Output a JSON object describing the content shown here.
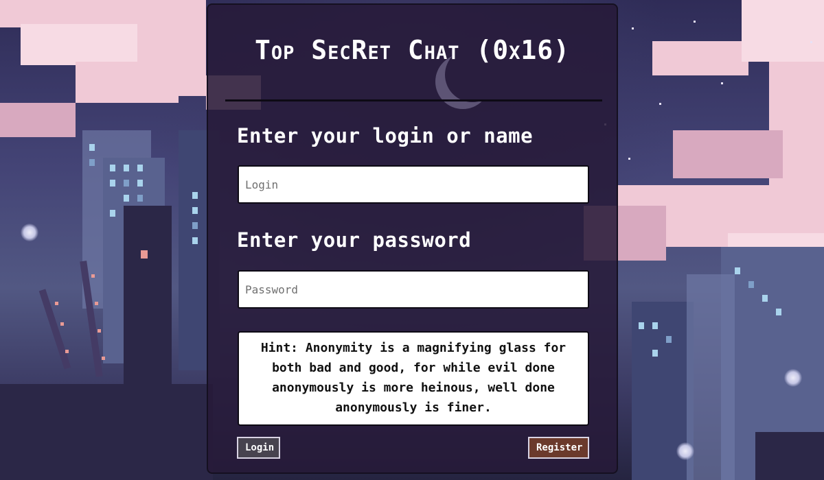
{
  "title": "Top SecRet Chat (0x16)",
  "login": {
    "label": "Enter your login or name",
    "placeholder": "Login",
    "value": ""
  },
  "password": {
    "label": "Enter your password",
    "placeholder": "Password",
    "value": ""
  },
  "hint": "Hint: Anonymity is a magnifying glass for both bad and good, for while evil done anonymously is more heinous, well done anonymously is finer.",
  "buttons": {
    "login": "Login",
    "register": "Register"
  },
  "colors": {
    "panel": "#261a38",
    "register_button": "#6b3a2c",
    "login_button": "#47434f",
    "sky_clouds": "#f0c9d6"
  },
  "icons": {
    "moon": "moon-icon"
  }
}
